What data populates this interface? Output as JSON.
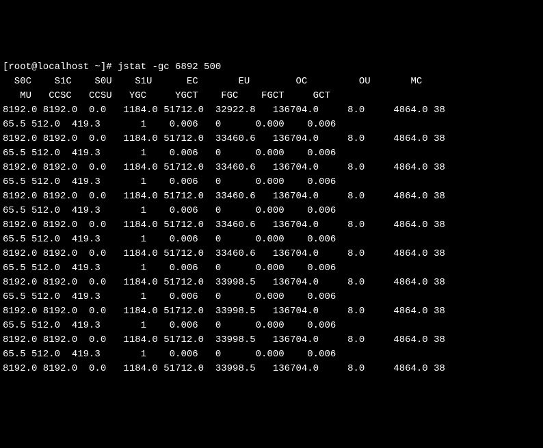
{
  "prompt": "[root@localhost ~]# ",
  "command": "jstat -gc 6892 500",
  "header1": "  S0C    S1C    S0U    S1U      EC       EU        OC         OU       MC",
  "header2": "   MU   CCSC   CCSU   YGC     YGCT    FGC    FGCT     GCT",
  "rows": [
    {
      "l1": "8192.0 8192.0  0.0   1184.0 51712.0  32922.8   136704.0     8.0     4864.0 38",
      "l2": "65.5 512.0  419.3       1    0.006   0      0.000    0.006"
    },
    {
      "l1": "8192.0 8192.0  0.0   1184.0 51712.0  33460.6   136704.0     8.0     4864.0 38",
      "l2": "65.5 512.0  419.3       1    0.006   0      0.000    0.006"
    },
    {
      "l1": "8192.0 8192.0  0.0   1184.0 51712.0  33460.6   136704.0     8.0     4864.0 38",
      "l2": "65.5 512.0  419.3       1    0.006   0      0.000    0.006"
    },
    {
      "l1": "8192.0 8192.0  0.0   1184.0 51712.0  33460.6   136704.0     8.0     4864.0 38",
      "l2": "65.5 512.0  419.3       1    0.006   0      0.000    0.006"
    },
    {
      "l1": "8192.0 8192.0  0.0   1184.0 51712.0  33460.6   136704.0     8.0     4864.0 38",
      "l2": "65.5 512.0  419.3       1    0.006   0      0.000    0.006"
    },
    {
      "l1": "8192.0 8192.0  0.0   1184.0 51712.0  33460.6   136704.0     8.0     4864.0 38",
      "l2": "65.5 512.0  419.3       1    0.006   0      0.000    0.006"
    },
    {
      "l1": "8192.0 8192.0  0.0   1184.0 51712.0  33998.5   136704.0     8.0     4864.0 38",
      "l2": "65.5 512.0  419.3       1    0.006   0      0.000    0.006"
    },
    {
      "l1": "8192.0 8192.0  0.0   1184.0 51712.0  33998.5   136704.0     8.0     4864.0 38",
      "l2": "65.5 512.0  419.3       1    0.006   0      0.000    0.006"
    },
    {
      "l1": "8192.0 8192.0  0.0   1184.0 51712.0  33998.5   136704.0     8.0     4864.0 38",
      "l2": "65.5 512.0  419.3       1    0.006   0      0.000    0.006"
    },
    {
      "l1": "8192.0 8192.0  0.0   1184.0 51712.0  33998.5   136704.0     8.0     4864.0 38",
      "l2": ""
    }
  ],
  "chart_data": {
    "type": "table",
    "title": "jstat -gc output",
    "columns": [
      "S0C",
      "S1C",
      "S0U",
      "S1U",
      "EC",
      "EU",
      "OC",
      "OU",
      "MC",
      "MU",
      "CCSC",
      "CCSU",
      "YGC",
      "YGCT",
      "FGC",
      "FGCT",
      "GCT"
    ],
    "rows": [
      [
        8192.0,
        8192.0,
        0.0,
        1184.0,
        51712.0,
        32922.8,
        136704.0,
        8.0,
        4864.0,
        3865.5,
        512.0,
        419.3,
        1,
        0.006,
        0,
        0.0,
        0.006
      ],
      [
        8192.0,
        8192.0,
        0.0,
        1184.0,
        51712.0,
        33460.6,
        136704.0,
        8.0,
        4864.0,
        3865.5,
        512.0,
        419.3,
        1,
        0.006,
        0,
        0.0,
        0.006
      ],
      [
        8192.0,
        8192.0,
        0.0,
        1184.0,
        51712.0,
        33460.6,
        136704.0,
        8.0,
        4864.0,
        3865.5,
        512.0,
        419.3,
        1,
        0.006,
        0,
        0.0,
        0.006
      ],
      [
        8192.0,
        8192.0,
        0.0,
        1184.0,
        51712.0,
        33460.6,
        136704.0,
        8.0,
        4864.0,
        3865.5,
        512.0,
        419.3,
        1,
        0.006,
        0,
        0.0,
        0.006
      ],
      [
        8192.0,
        8192.0,
        0.0,
        1184.0,
        51712.0,
        33460.6,
        136704.0,
        8.0,
        4864.0,
        3865.5,
        512.0,
        419.3,
        1,
        0.006,
        0,
        0.0,
        0.006
      ],
      [
        8192.0,
        8192.0,
        0.0,
        1184.0,
        51712.0,
        33460.6,
        136704.0,
        8.0,
        4864.0,
        3865.5,
        512.0,
        419.3,
        1,
        0.006,
        0,
        0.0,
        0.006
      ],
      [
        8192.0,
        8192.0,
        0.0,
        1184.0,
        51712.0,
        33998.5,
        136704.0,
        8.0,
        4864.0,
        3865.5,
        512.0,
        419.3,
        1,
        0.006,
        0,
        0.0,
        0.006
      ],
      [
        8192.0,
        8192.0,
        0.0,
        1184.0,
        51712.0,
        33998.5,
        136704.0,
        8.0,
        4864.0,
        3865.5,
        512.0,
        419.3,
        1,
        0.006,
        0,
        0.0,
        0.006
      ],
      [
        8192.0,
        8192.0,
        0.0,
        1184.0,
        51712.0,
        33998.5,
        136704.0,
        8.0,
        4864.0,
        3865.5,
        512.0,
        419.3,
        1,
        0.006,
        0,
        0.0,
        0.006
      ]
    ]
  }
}
